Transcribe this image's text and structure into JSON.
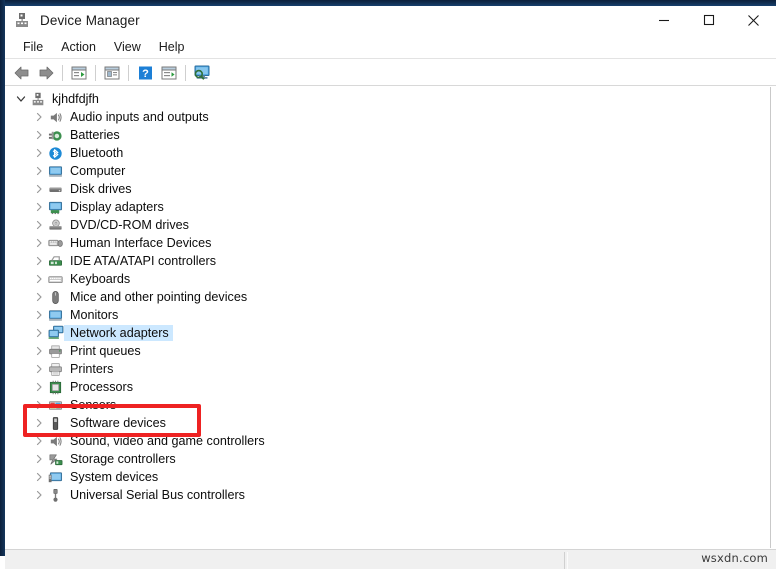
{
  "window": {
    "title": "Device Manager",
    "icon": "device-manager-icon",
    "controls": {
      "minimize_label": "–",
      "maximize_label": "□",
      "close_label": "✕"
    }
  },
  "menubar": {
    "items": [
      {
        "label": "File",
        "name": "menu-file"
      },
      {
        "label": "Action",
        "name": "menu-action"
      },
      {
        "label": "View",
        "name": "menu-view"
      },
      {
        "label": "Help",
        "name": "menu-help"
      }
    ]
  },
  "toolbar": {
    "buttons": [
      {
        "name": "back-icon",
        "title": "Back"
      },
      {
        "name": "forward-icon",
        "title": "Forward"
      },
      {
        "name": "show-hide-console-tree-icon",
        "title": "Show/Hide Console Tree"
      },
      {
        "name": "properties-icon",
        "title": "Properties"
      },
      {
        "name": "help-icon",
        "title": "Help"
      },
      {
        "name": "update-driver-icon",
        "title": "Update driver"
      },
      {
        "name": "scan-for-hardware-changes-icon",
        "title": "Scan for hardware changes"
      }
    ]
  },
  "tree": {
    "root": {
      "label": "kjhdfdjfh",
      "icon": "computer-root-icon",
      "expanded": true,
      "chevron": "chevron-down-icon"
    },
    "items": [
      {
        "label": "Audio inputs and outputs",
        "icon": "speaker-icon"
      },
      {
        "label": "Batteries",
        "icon": "battery-icon"
      },
      {
        "label": "Bluetooth",
        "icon": "bluetooth-icon"
      },
      {
        "label": "Computer",
        "icon": "computer-icon"
      },
      {
        "label": "Disk drives",
        "icon": "disk-drive-icon"
      },
      {
        "label": "Display adapters",
        "icon": "display-adapter-icon"
      },
      {
        "label": "DVD/CD-ROM drives",
        "icon": "dvd-drive-icon"
      },
      {
        "label": "Human Interface Devices",
        "icon": "hid-icon"
      },
      {
        "label": "IDE ATA/ATAPI controllers",
        "icon": "ide-controller-icon"
      },
      {
        "label": "Keyboards",
        "icon": "keyboard-icon"
      },
      {
        "label": "Mice and other pointing devices",
        "icon": "mouse-icon"
      },
      {
        "label": "Monitors",
        "icon": "monitor-icon"
      },
      {
        "label": "Network adapters",
        "icon": "network-adapter-icon",
        "selected": true
      },
      {
        "label": "Print queues",
        "icon": "print-queue-icon"
      },
      {
        "label": "Printers",
        "icon": "printer-icon"
      },
      {
        "label": "Processors",
        "icon": "processor-icon"
      },
      {
        "label": "Sensors",
        "icon": "sensor-icon"
      },
      {
        "label": "Software devices",
        "icon": "software-device-icon"
      },
      {
        "label": "Sound, video and game controllers",
        "icon": "sound-controller-icon"
      },
      {
        "label": "Storage controllers",
        "icon": "storage-controller-icon"
      },
      {
        "label": "System devices",
        "icon": "system-device-icon"
      },
      {
        "label": "Universal Serial Bus controllers",
        "icon": "usb-controller-icon"
      }
    ],
    "collapsed_chevron": "chevron-right-icon"
  },
  "annotation": {
    "target_label": "Network adapters",
    "color": "#ee2222"
  },
  "statusbar": {
    "left_text": "",
    "right_text": "",
    "watermark": "wsxdn.com"
  },
  "colors": {
    "frame": "#0b1f3b",
    "selection": "#cce8ff",
    "annotation": "#ee2222",
    "statusbar": "#f0f0f0"
  }
}
